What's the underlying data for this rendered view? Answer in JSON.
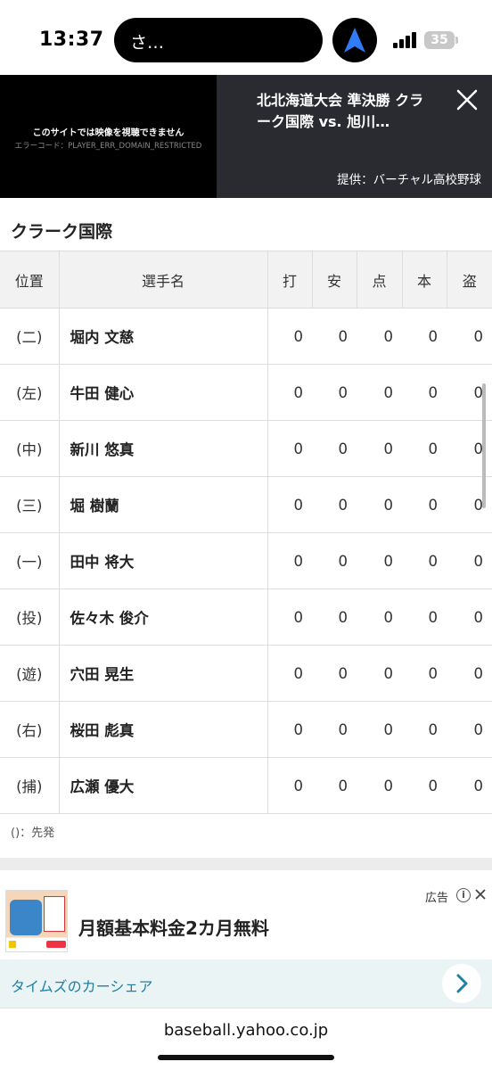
{
  "status_bar": {
    "time": "13:37",
    "island_text": "さ…",
    "battery": "35",
    "icons": [
      "navigation-arrow-icon",
      "signal-icon",
      "battery-icon"
    ]
  },
  "video": {
    "player_message": "このサイトでは映像を視聴できません",
    "player_error": "エラーコード：PLAYER_ERR_DOMAIN_RESTRICTED",
    "title": "北北海道大会 準決勝 クラーク国際 vs. 旭川…",
    "provider": "提供：バーチャル高校野球"
  },
  "team": {
    "name": "クラーク国際",
    "headers": [
      "位置",
      "選手名",
      "打",
      "安",
      "点",
      "本",
      "盗"
    ],
    "players": [
      {
        "pos": "(二)",
        "name": "堀内 文慈",
        "stats": [
          "0",
          "0",
          "0",
          "0",
          "0"
        ]
      },
      {
        "pos": "(左)",
        "name": "牛田 健心",
        "stats": [
          "0",
          "0",
          "0",
          "0",
          "0"
        ]
      },
      {
        "pos": "(中)",
        "name": "新川 悠真",
        "stats": [
          "0",
          "0",
          "0",
          "0",
          "0"
        ]
      },
      {
        "pos": "(三)",
        "name": "堀 樹蘭",
        "stats": [
          "0",
          "0",
          "0",
          "0",
          "0"
        ]
      },
      {
        "pos": "(一)",
        "name": "田中 将大",
        "stats": [
          "0",
          "0",
          "0",
          "0",
          "0"
        ]
      },
      {
        "pos": "(投)",
        "name": "佐々木 俊介",
        "stats": [
          "0",
          "0",
          "0",
          "0",
          "0"
        ]
      },
      {
        "pos": "(遊)",
        "name": "穴田 晃生",
        "stats": [
          "0",
          "0",
          "0",
          "0",
          "0"
        ]
      },
      {
        "pos": "(右)",
        "name": "桜田 彪真",
        "stats": [
          "0",
          "0",
          "0",
          "0",
          "0"
        ]
      },
      {
        "pos": "(捕)",
        "name": "広瀬 優大",
        "stats": [
          "0",
          "0",
          "0",
          "0",
          "0"
        ]
      }
    ],
    "legend": "()：先発"
  },
  "ad": {
    "label": "広告",
    "headline": "月額基本料金2カ月無料",
    "advertiser": "タイムズのカーシェア"
  },
  "browser": {
    "url": "baseball.yahoo.co.jp"
  }
}
